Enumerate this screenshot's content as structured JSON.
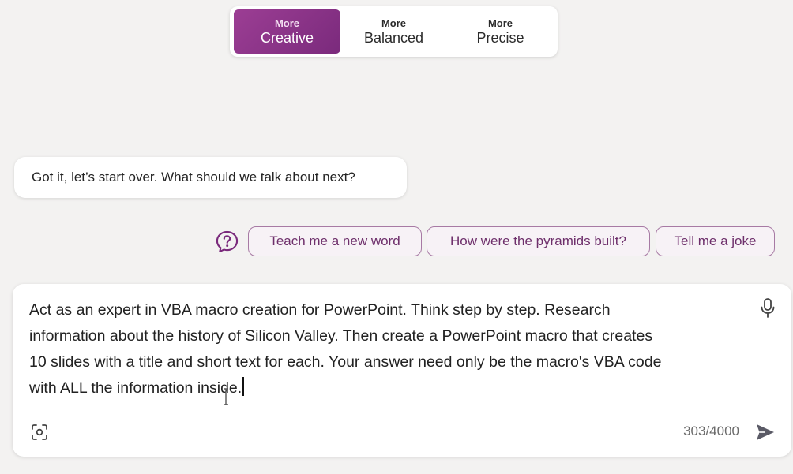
{
  "tone_selector": {
    "options": [
      {
        "small": "More",
        "big": "Creative",
        "selected": true
      },
      {
        "small": "More",
        "big": "Balanced",
        "selected": false
      },
      {
        "small": "More",
        "big": "Precise",
        "selected": false
      }
    ]
  },
  "conversation": {
    "bot_message": "Got it, let’s start over. What should we talk about next?"
  },
  "suggestions": {
    "help_icon": "question-circle-icon",
    "chips": [
      "Teach me a new word",
      "How were the pyramids built?",
      "Tell me a joke"
    ]
  },
  "composer": {
    "text": "Act as an expert in VBA macro creation for PowerPoint. Think step by step. Research\ninformation about the history of Silicon Valley. Then create a PowerPoint macro that creates\n10 slides with a title and short text for each. Your answer need only be the macro's VBA code\nwith ALL the information inside.",
    "char_count": "303/4000",
    "icons": {
      "mic": "microphone-icon",
      "scan": "visual-search-icon",
      "send": "send-icon"
    }
  },
  "colors": {
    "accent": "#8e3586",
    "chip_border": "#a77aa4",
    "background": "#f3f2f1"
  }
}
